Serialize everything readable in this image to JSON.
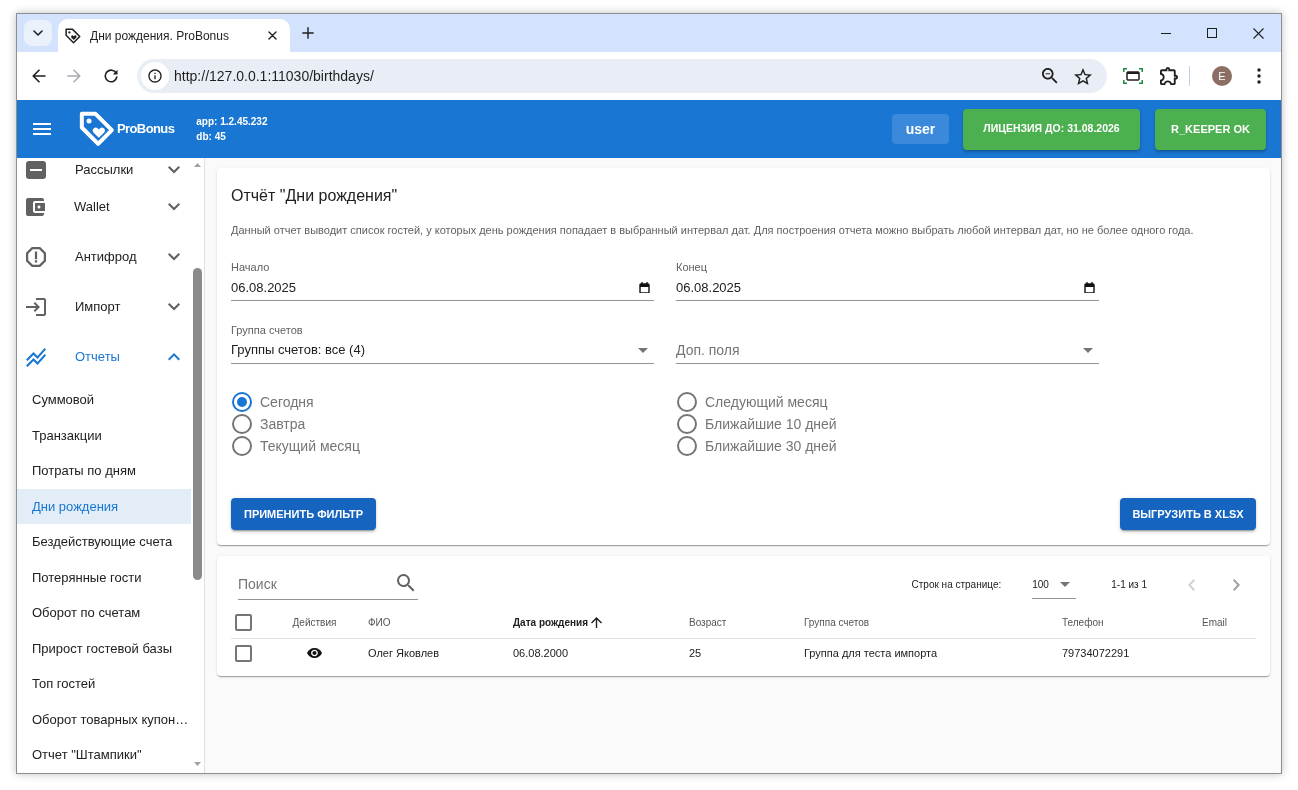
{
  "browser": {
    "tab_title": "Дни рождения. ProBonus",
    "url": "http://127.0.0.1:11030/birthdays/",
    "forward_disabled": true,
    "profile_initial": "E"
  },
  "header": {
    "brand": "ProBonus",
    "app_version": "app: 1.2.45.232",
    "db_version": "db: 45",
    "user": "user",
    "license": "ЛИЦЕНЗИЯ ДО: 31.08.2026",
    "integration_status": "R_KEEPER OK"
  },
  "sidebar": {
    "items": [
      {
        "label": "Рассылки",
        "expanded": false
      },
      {
        "label": "Wallet",
        "expanded": false
      },
      {
        "label": "Антифрод",
        "expanded": false
      },
      {
        "label": "Импорт",
        "expanded": false
      },
      {
        "label": "Отчеты",
        "expanded": true,
        "children": [
          {
            "label": "Суммовой",
            "selected": false
          },
          {
            "label": "Транзакции",
            "selected": false
          },
          {
            "label": "Потраты по дням",
            "selected": false
          },
          {
            "label": "Дни рождения",
            "selected": true
          },
          {
            "label": "Бездействующие счета",
            "selected": false
          },
          {
            "label": "Потерянные гости",
            "selected": false
          },
          {
            "label": "Оборот по счетам",
            "selected": false
          },
          {
            "label": "Прирост гостевой базы",
            "selected": false
          },
          {
            "label": "Топ гостей",
            "selected": false
          },
          {
            "label": "Оборот товарных купон…",
            "selected": false
          },
          {
            "label": "Отчет \"Штампики\"",
            "selected": false
          }
        ]
      }
    ]
  },
  "report": {
    "title": "Отчёт \"Дни рождения\"",
    "description": "Данный отчет выводит список гостей, у которых день рождения попадает в выбранный интервал дат. Для построения отчета можно выбрать любой интервал дат, но не более одного года.",
    "start": {
      "label": "Начало",
      "value": "06.08.2025"
    },
    "end": {
      "label": "Конец",
      "value": "06.08.2025"
    },
    "account_group": {
      "label": "Группа счетов",
      "value": "Группы счетов: все (4)"
    },
    "extra_fields": {
      "placeholder": "Доп. поля"
    },
    "periods": [
      {
        "label": "Сегодня",
        "selected": true
      },
      {
        "label": "Завтра",
        "selected": false
      },
      {
        "label": "Текущий месяц",
        "selected": false
      },
      {
        "label": "Следующий месяц",
        "selected": false
      },
      {
        "label": "Ближайшие 10 дней",
        "selected": false
      },
      {
        "label": "Ближайшие 30 дней",
        "selected": false
      }
    ],
    "apply_button": "ПРИМЕНИТЬ ФИЛЬТР",
    "export_button": "ВЫГРУЗИТЬ В XLSX"
  },
  "table": {
    "search": {
      "placeholder": "Поиск"
    },
    "rows_per_page_label": "Строк на странице:",
    "rows_per_page": "100",
    "range": "1-1 из 1",
    "prev_disabled": true,
    "next_disabled": false,
    "select_all_checked": false,
    "columns": [
      {
        "label": "Действия",
        "sorted": false
      },
      {
        "label": "ФИО",
        "sorted": false
      },
      {
        "label": "Дата рождения",
        "sorted": true
      },
      {
        "label": "Возраст",
        "sorted": false
      },
      {
        "label": "Группа счетов",
        "sorted": false
      },
      {
        "label": "Телефон",
        "sorted": false
      },
      {
        "label": "Email",
        "sorted": false
      }
    ],
    "rows": [
      {
        "checked": false,
        "cells": [
          "",
          "Олег Яковлев",
          "06.08.2000",
          "25",
          "Группа для теста импорта",
          "79734072291"
        ]
      }
    ]
  }
}
